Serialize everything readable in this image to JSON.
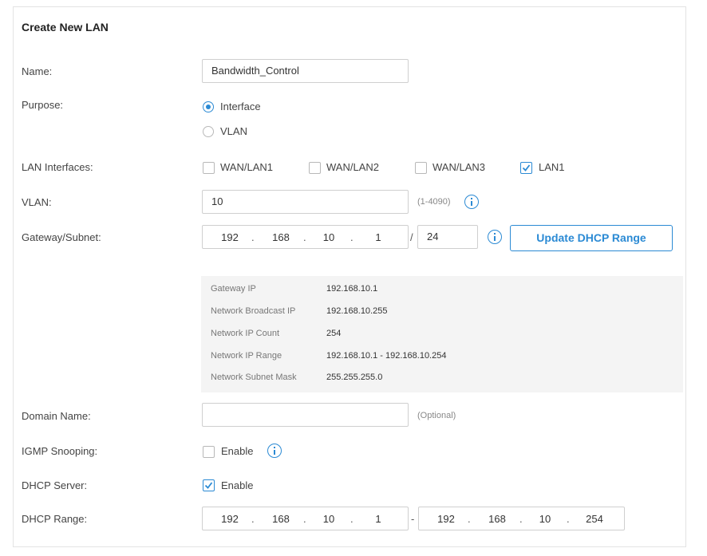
{
  "title": "Create New LAN",
  "name": {
    "label": "Name:",
    "value": "Bandwidth_Control"
  },
  "purpose": {
    "label": "Purpose:",
    "options": [
      {
        "label": "Interface",
        "selected": true
      },
      {
        "label": "VLAN",
        "selected": false
      }
    ]
  },
  "lan_interfaces": {
    "label": "LAN Interfaces:",
    "options": [
      {
        "label": "WAN/LAN1",
        "checked": false
      },
      {
        "label": "WAN/LAN2",
        "checked": false
      },
      {
        "label": "WAN/LAN3",
        "checked": false
      },
      {
        "label": "LAN1",
        "checked": true
      }
    ]
  },
  "vlan": {
    "label": "VLAN:",
    "value": "10",
    "hint": "(1-4090)"
  },
  "gateway": {
    "label": "Gateway/Subnet:",
    "octets": [
      "192",
      "168",
      "10",
      "1"
    ],
    "mask": "24",
    "button": "Update DHCP Range"
  },
  "summary": [
    {
      "key": "Gateway IP",
      "value": "192.168.10.1"
    },
    {
      "key": "Network Broadcast IP",
      "value": "192.168.10.255"
    },
    {
      "key": "Network IP Count",
      "value": "254"
    },
    {
      "key": "Network IP Range",
      "value": "192.168.10.1 - 192.168.10.254"
    },
    {
      "key": "Network Subnet Mask",
      "value": "255.255.255.0"
    }
  ],
  "domain": {
    "label": "Domain Name:",
    "value": "",
    "hint": "(Optional)"
  },
  "igmp": {
    "label": "IGMP Snooping:",
    "option": "Enable",
    "checked": false
  },
  "dhcp_server": {
    "label": "DHCP Server:",
    "option": "Enable",
    "checked": true
  },
  "dhcp_range": {
    "label": "DHCP Range:",
    "start": [
      "192",
      "168",
      "10",
      "1"
    ],
    "separator": "-",
    "end": [
      "192",
      "168",
      "10",
      "254"
    ]
  },
  "colors": {
    "accent": "#2b8ad4",
    "summary_bg": "#f4f4f4",
    "border": "#cfcfcf"
  },
  "icons": {
    "info": "info-circle-icon",
    "check": "checkmark-icon"
  }
}
